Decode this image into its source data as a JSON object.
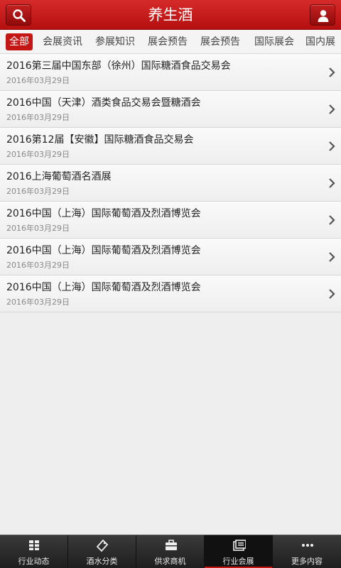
{
  "header": {
    "title": "养生酒",
    "search_icon": "search-icon",
    "user_icon": "user-icon"
  },
  "tabs": [
    {
      "label": "全部",
      "active": true
    },
    {
      "label": "会展资讯"
    },
    {
      "label": "参展知识"
    },
    {
      "label": "展会预告"
    },
    {
      "label": "展会预告"
    },
    {
      "label": "国际展会"
    },
    {
      "label": "国内展"
    }
  ],
  "items": [
    {
      "title": "2016第三届中国东部（徐州）国际糖酒食品交易会",
      "date": "2016年03月29日"
    },
    {
      "title": "2016中国（天津）酒类食品交易会暨糖酒会",
      "date": "2016年03月29日"
    },
    {
      "title": "2016第12届【安徽】国际糖酒食品交易会",
      "date": "2016年03月29日"
    },
    {
      "title": "2016上海葡萄酒名酒展",
      "date": "2016年03月29日"
    },
    {
      "title": "2016中国（上海）国际葡萄酒及烈酒博览会",
      "date": "2016年03月29日"
    },
    {
      "title": "2016中国（上海）国际葡萄酒及烈酒博览会",
      "date": "2016年03月29日"
    },
    {
      "title": "2016中国（上海）国际葡萄酒及烈酒博览会",
      "date": "2016年03月29日"
    }
  ],
  "bottom_nav": [
    {
      "label": "行业动态",
      "icon": "grid-icon"
    },
    {
      "label": "酒水分类",
      "icon": "tag-icon"
    },
    {
      "label": "供求商机",
      "icon": "briefcase-icon"
    },
    {
      "label": "行业会展",
      "icon": "calendar-icon",
      "active": true
    },
    {
      "label": "更多内容",
      "icon": "more-icon"
    }
  ],
  "colors": {
    "brand_red": "#c51616",
    "header_red": "#d62a2a",
    "nav_dark": "#2a2a2a"
  }
}
